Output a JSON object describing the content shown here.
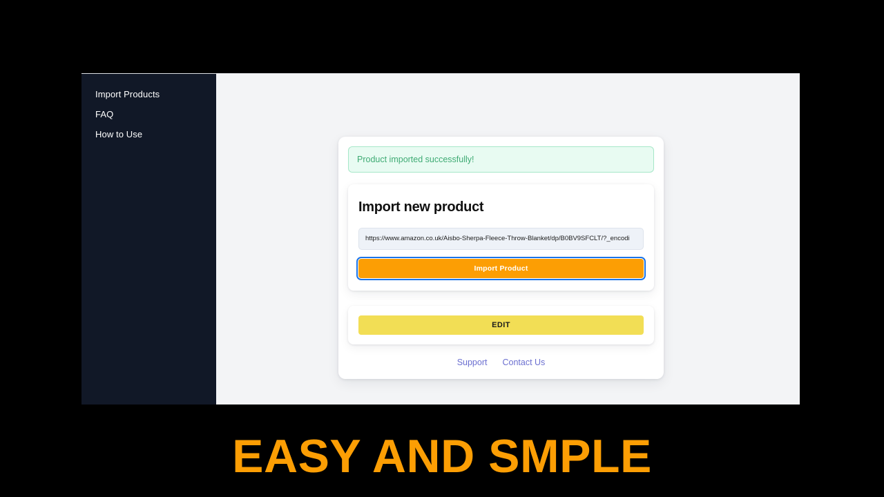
{
  "sidebar": {
    "items": [
      {
        "label": "Import Products"
      },
      {
        "label": "FAQ"
      },
      {
        "label": "How to Use"
      }
    ]
  },
  "alert": {
    "message": "Product imported successfully!"
  },
  "import_card": {
    "title": "Import new product",
    "url_value": "https://www.amazon.co.uk/Aisbo-Sherpa-Fleece-Throw-Blanket/dp/B0BV9SFCLT/?_encodi",
    "url_placeholder": "https://",
    "submit_label": "Import Product"
  },
  "edit_card": {
    "edit_label": "EDIT"
  },
  "footer": {
    "links": [
      {
        "label": "Support"
      },
      {
        "label": "Contact Us"
      }
    ]
  },
  "caption": {
    "text": "EASY AND SMPLE"
  },
  "colors": {
    "sidebar_background": "#111827",
    "content_background": "#f3f4f6",
    "accent_orange": "#fc9e04",
    "accent_yellow": "#f2de55",
    "success_text": "#3fab74",
    "success_background": "#e8fbf2",
    "success_border": "#a6e7c8",
    "link_indigo": "#6b6fd0",
    "focus_ring_blue": "#1a73e8",
    "stage_background": "#000000"
  }
}
